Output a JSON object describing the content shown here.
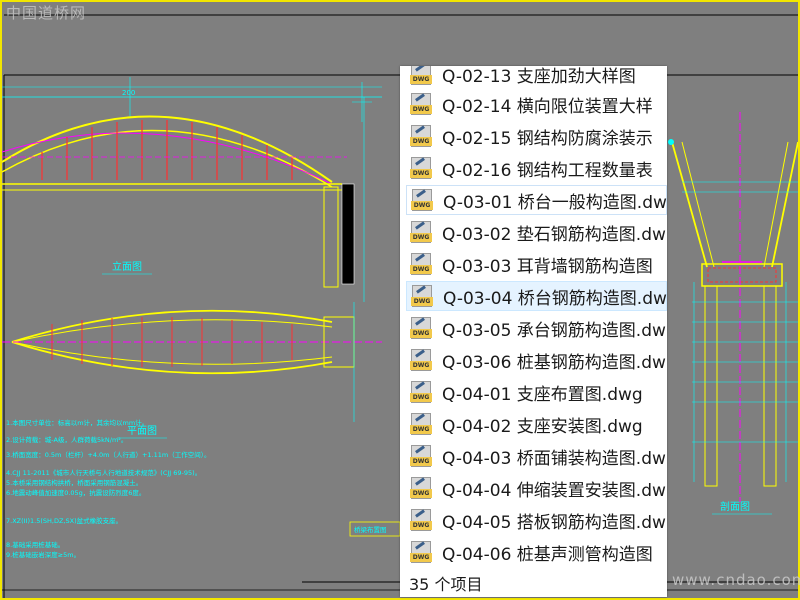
{
  "watermark": {
    "top": "中国道桥网",
    "bottom": "www.cndao.com"
  },
  "drawing": {
    "labels": {
      "elevation": "立面图",
      "plan": "平面图",
      "section": "剖面图",
      "note_title": "桥梁布置图",
      "dim": "200"
    },
    "notes": [
      "1.本图尺寸单位：标高以m计，其余均以mm计。",
      "2.设计荷载：城-A级，人群荷载5kN/m²。",
      "3.桥面宽度：0.5m（栏杆）+4.0m（人行道）+1.11m（工作空间）。",
      "4.CJJ 11-2011《城市人行天桥与人行地道技术规范》(CJJ 69-95)。",
      "5.本桥采用钢结构拱桥，桥面采用钢筋混凝土。",
      "6.地震动峰值加速度0.05g，抗震设防烈度6度。",
      "7.XZ(II)1.5(SH,DZ,SX)盆式橡胶支座。",
      "8.基础采用桩基础。",
      "9.桩基础嵌岩深度≥5m。"
    ]
  },
  "file_list": {
    "items": [
      {
        "name": "Q-02-13 支座加劲大样图",
        "state": "normal"
      },
      {
        "name": "Q-02-14 横向限位装置大样",
        "state": "normal"
      },
      {
        "name": "Q-02-15 钢结构防腐涂装示",
        "state": "normal"
      },
      {
        "name": "Q-02-16 钢结构工程数量表",
        "state": "normal"
      },
      {
        "name": "Q-03-01 桥台一般构造图.dw",
        "state": "hovered"
      },
      {
        "name": "Q-03-02 垫石钢筋构造图.dw",
        "state": "normal"
      },
      {
        "name": "Q-03-03 耳背墙钢筋构造图",
        "state": "normal"
      },
      {
        "name": "Q-03-04 桥台钢筋构造图.dw",
        "state": "selected"
      },
      {
        "name": "Q-03-05 承台钢筋构造图.dw",
        "state": "normal"
      },
      {
        "name": "Q-03-06 桩基钢筋构造图.dw",
        "state": "normal"
      },
      {
        "name": "Q-04-01 支座布置图.dwg",
        "state": "normal"
      },
      {
        "name": "Q-04-02 支座安装图.dwg",
        "state": "normal"
      },
      {
        "name": "Q-04-03 桥面铺装构造图.dw",
        "state": "normal"
      },
      {
        "name": "Q-04-04 伸缩装置安装图.dw",
        "state": "normal"
      },
      {
        "name": "Q-04-05 搭板钢筋构造图.dw",
        "state": "normal"
      },
      {
        "name": "Q-04-06 桩基声测管构造图",
        "state": "normal"
      }
    ],
    "icon": "dwg-file-icon",
    "icon_badge": "DWG"
  },
  "status": {
    "item_count": "35 个项目"
  },
  "colors": {
    "frame": "#f2e600",
    "cad_yellow": "#ffff00",
    "cad_cyan": "#00ffff",
    "cad_magenta": "#ff00ff",
    "cad_red": "#ff3030",
    "selection": "#e5f3ff"
  }
}
